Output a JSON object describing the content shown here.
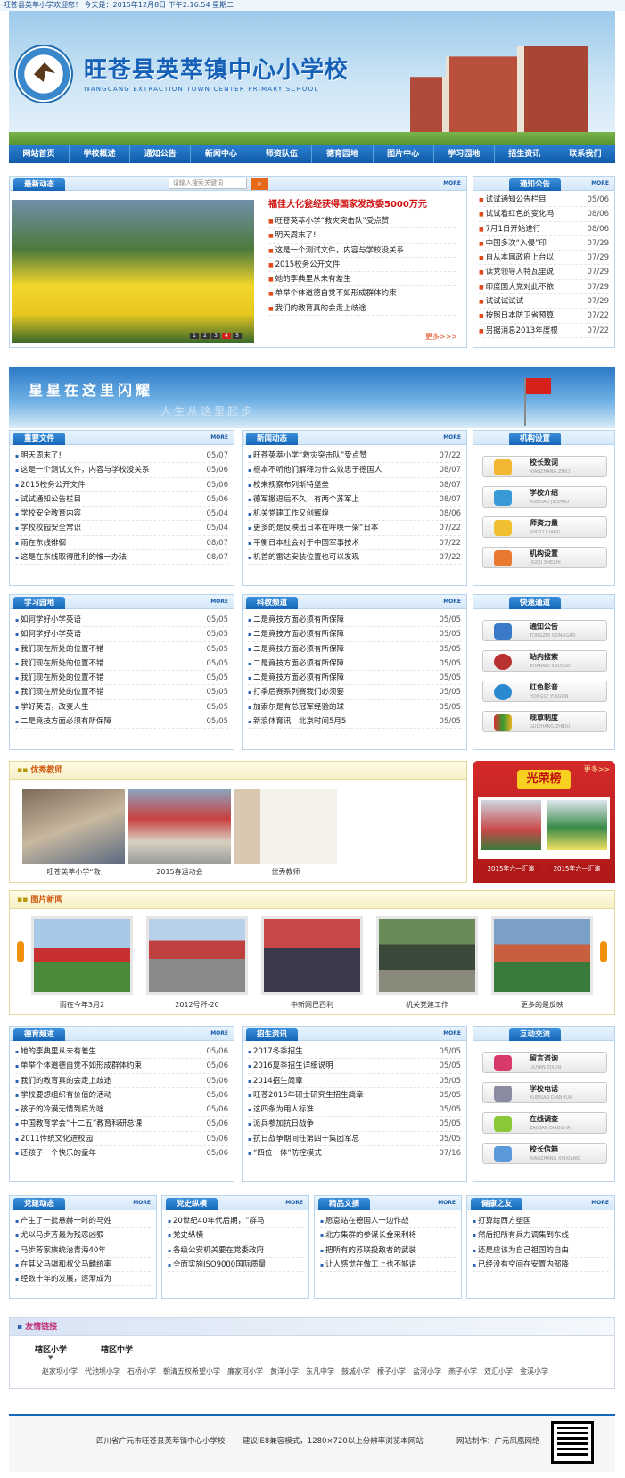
{
  "top": {
    "welcome": "旺苍县英萃小学欢迎您！  今天是：2015年12月8日 下午2:16:54 星期二"
  },
  "banner": {
    "school_name": "旺苍县英萃镇中心小学校",
    "english_name": "WANGCANG  EXTRACTION  TOWN  CENTER  PRIMARY    SCHOOL"
  },
  "nav": [
    "网站首页",
    "学校概述",
    "通知公告",
    "新闻中心",
    "师资队伍",
    "德育园地",
    "图片中心",
    "学习园地",
    "招生资讯",
    "联系我们"
  ],
  "latest": {
    "title": "最新动态",
    "search_placeholder": "请输入搜索关键词",
    "more": "MORE",
    "headline": "福佳大化瓮经获得国家发改委5000万元",
    "items": [
      "旺苍英萃小学“救灾突击队”受点赞",
      "明天周末了!",
      "这是一个测试文件，内容与学校没关系",
      "2015校务公开文件",
      "她的李典里从未有差生",
      "单举个体道德自觉不如形成群体约束",
      "我们的教育真的会走上歧途"
    ],
    "more_link": "更多>>>",
    "pages": [
      "1",
      "2",
      "3",
      "4",
      "5"
    ]
  },
  "notice": {
    "title": "通知公告",
    "more": "MORE",
    "items": [
      {
        "t": "试试通知公告栏目",
        "d": "05/06"
      },
      {
        "t": "试试看红色的变化吗",
        "d": "08/06"
      },
      {
        "t": "7月1日开始进行",
        "d": "08/06"
      },
      {
        "t": "中国多次“入侵”印",
        "d": "07/29"
      },
      {
        "t": "自从本届政府上台以",
        "d": "07/29"
      },
      {
        "t": "读党领导人特瓦里说",
        "d": "07/29"
      },
      {
        "t": "印度国大党对此不依",
        "d": "07/29"
      },
      {
        "t": "试试试试试",
        "d": "07/29"
      },
      {
        "t": "按照日本防卫省预算",
        "d": "07/22"
      },
      {
        "t": "另据消息2013年度根",
        "d": "07/22"
      }
    ]
  },
  "stars": {
    "text1": "星星在这里闪耀",
    "text2": "人生从这里起步"
  },
  "important": {
    "title": "重要文件",
    "more": "MORE",
    "items": [
      {
        "t": "明天周末了!",
        "d": "05/07"
      },
      {
        "t": "这是一个测试文件，内容与学校没关系",
        "d": "05/06"
      },
      {
        "t": "2015校务公开文件",
        "d": "05/06"
      },
      {
        "t": "试试通知公告栏目",
        "d": "05/06"
      },
      {
        "t": "学校安全教育内容",
        "d": "05/04"
      },
      {
        "t": "学校校园安全常识",
        "d": "05/04"
      },
      {
        "t": "雨在东线徘徊",
        "d": "08/07"
      },
      {
        "t": "这是在东线取得胜利的惟一办法",
        "d": "08/07"
      }
    ]
  },
  "news": {
    "title": "新闻动态",
    "more": "MORE",
    "items": [
      {
        "t": "旺苍英萃小学“救灾突击队”受点赞",
        "d": "07/22"
      },
      {
        "t": "根本不听他们解释为什么效忠于德国人",
        "d": "08/07"
      },
      {
        "t": "校来视察布列斯特堡垒",
        "d": "08/07"
      },
      {
        "t": "德军撤退后不久，有两个苏军上",
        "d": "08/07"
      },
      {
        "t": "机关党建工作又创辉煌",
        "d": "08/06"
      },
      {
        "t": "更多的是反映出日本在呼唤一架“日本",
        "d": "07/22"
      },
      {
        "t": "平衡日本社会对于中国军事技术",
        "d": "07/22"
      },
      {
        "t": "机首的雷达安装位置也可以发现",
        "d": "07/22"
      }
    ]
  },
  "org": {
    "title": "机构设置",
    "buttons": [
      {
        "label": "校长致词",
        "sub": "XIAOZHANG ZHICI"
      },
      {
        "label": "学校介绍",
        "sub": "XUEXIAO JIESHAO"
      },
      {
        "label": "师资力量",
        "sub": "SHIZI LILIANG"
      },
      {
        "label": "机构设置",
        "sub": "JIGOU SHEZHI"
      }
    ]
  },
  "study": {
    "title": "学习园地",
    "more": "MORE",
    "items": [
      {
        "t": "如何学好小学英语",
        "d": "05/05"
      },
      {
        "t": "如何学好小学英语",
        "d": "05/05"
      },
      {
        "t": "我们现在所处的位置不错",
        "d": "05/05"
      },
      {
        "t": "我们现在所处的位置不错",
        "d": "05/05"
      },
      {
        "t": "我们现在所处的位置不错",
        "d": "05/05"
      },
      {
        "t": "我们现在所处的位置不错",
        "d": "05/05"
      },
      {
        "t": "学好英语，改变人生",
        "d": "05/05"
      },
      {
        "t": "二是竟技方面必须有所保障",
        "d": "05/05"
      }
    ]
  },
  "science": {
    "title": "科教频道",
    "more": "MORE",
    "items": [
      {
        "t": "二是竟技方面必须有所保障",
        "d": "05/05"
      },
      {
        "t": "二是竟技方面必须有所保障",
        "d": "05/05"
      },
      {
        "t": "二是竟技方面必须有所保障",
        "d": "05/05"
      },
      {
        "t": "二是竟技方面必须有所保障",
        "d": "05/05"
      },
      {
        "t": "二是竟技方面必须有所保障",
        "d": "05/05"
      },
      {
        "t": "打季后赛系列赛我们必须要",
        "d": "05/05"
      },
      {
        "t": "加索尔是有总冠军经验的球",
        "d": "05/05"
      },
      {
        "t": "新浪体育讯　北京时间5月5",
        "d": "05/05"
      }
    ]
  },
  "quick": {
    "title": "快速通道",
    "buttons": [
      {
        "label": "通知公告",
        "sub": "TONGZHI GONGGAO"
      },
      {
        "label": "站内搜索",
        "sub": "ZHANNEI SOUSUO"
      },
      {
        "label": "红色影音",
        "sub": "HONGSE YINGYIN"
      },
      {
        "label": "规章制度",
        "sub": "GUIZHANG ZHIDU"
      }
    ]
  },
  "teachers": {
    "title": "优秀教师",
    "items": [
      "旺苍英萃小学“救",
      "2015春运动会",
      "优秀教师"
    ]
  },
  "honor": {
    "title": "光荣榜",
    "more": "更多>>",
    "items": [
      "2015年六一汇演",
      "2015年六一汇演"
    ]
  },
  "photos": {
    "title": "图片新闻",
    "items": [
      "雨在今年3月2",
      "2012号歼-20",
      "中新网巴西利",
      "机关党建工作",
      "更多的是反映"
    ]
  },
  "moral": {
    "title": "德育频道",
    "more": "MORE",
    "items": [
      {
        "t": "她的李典里从未有差生",
        "d": "05/06"
      },
      {
        "t": "单举个体道德自觉不如形成群体约束",
        "d": "05/06"
      },
      {
        "t": "我们的教育真的会走上歧途",
        "d": "05/06"
      },
      {
        "t": "学校要想组织有价值的活动",
        "d": "05/06"
      },
      {
        "t": "孩子的冷漠无情到底为啥",
        "d": "05/06"
      },
      {
        "t": "中国教育学会“十二五”教育科研总课",
        "d": "05/06"
      },
      {
        "t": "2011传统文化进校园",
        "d": "05/06"
      },
      {
        "t": "还孩子一个快乐的童年",
        "d": "05/06"
      }
    ]
  },
  "enroll": {
    "title": "招生资讯",
    "more": "MORE",
    "items": [
      {
        "t": "2017冬季招生",
        "d": "05/05"
      },
      {
        "t": "2016夏季招生详细说明",
        "d": "05/05"
      },
      {
        "t": "2014招生简章",
        "d": "05/05"
      },
      {
        "t": "旺苍2015年硕士研究生招生简章",
        "d": "05/05"
      },
      {
        "t": "这四条为用人标准",
        "d": "05/05"
      },
      {
        "t": "派兵参加抗日战争",
        "d": "05/05"
      },
      {
        "t": "抗日战争期间任第四十集团军总",
        "d": "05/05"
      },
      {
        "t": "“四位一体”防控模式",
        "d": "07/16"
      }
    ]
  },
  "interact": {
    "title": "互动交流",
    "buttons": [
      {
        "label": "留言咨询",
        "sub": "LIUYAN ZIXUN"
      },
      {
        "label": "学校电话",
        "sub": "XUEXIAO DIANHUA"
      },
      {
        "label": "在线调查",
        "sub": "ZAIXIAN DIAOCHA"
      },
      {
        "label": "校长信箱",
        "sub": "XIAOZHANG XINXIANG"
      }
    ]
  },
  "party": {
    "title": "党建动态",
    "more": "MORE",
    "items": [
      "产生了一批悬赫一时的马姓",
      "尤以马步芳最为残忍凶狠",
      "马步芳家族统治青海40年",
      "在其父马骐和叔父马麟统率",
      "经数十年的发展，逐渐成为"
    ]
  },
  "history": {
    "title": "党史纵横",
    "more": "MORE",
    "items": [
      "20世纪40年代后期，“群马",
      "党史纵横",
      "各级公安机关要在党委政府",
      "全面实施ISO9000国际质量"
    ]
  },
  "essay": {
    "title": "精品文摘",
    "more": "MORE",
    "items": [
      "愿意站在德国人一边作战",
      "北方集群的参谋长金采利将",
      "把所有的苏联投敌者的武装",
      "让人感觉在做工上也不够讲"
    ]
  },
  "health": {
    "title": "健康之友",
    "more": "MORE",
    "items": [
      "打算给西方塑国",
      "然后把所有兵力调集到东线",
      "还是应该为自己祖国的自由",
      "已经没有空间在安置内部降"
    ]
  },
  "links": {
    "title": "友情链接",
    "tabs": [
      "辖区小学",
      "辖区中学"
    ],
    "items": [
      "赵家坝小学",
      "代池坝小学",
      "石桥小学",
      "朝清五权希望小学",
      "廉家河小学",
      "黄洋小学",
      "东凡中学",
      "鼓城小学",
      "檬子小学",
      "盐河小学",
      "燕子小学",
      "双汇小学",
      "金溪小学"
    ]
  },
  "footer": {
    "school": "四川省广元市旺苍县英萃镇中心小学校",
    "tip": "建议IE8兼容模式，1280×720以上分辨率浏览本网站",
    "maker": "网站制作：广元凤凰网络"
  }
}
